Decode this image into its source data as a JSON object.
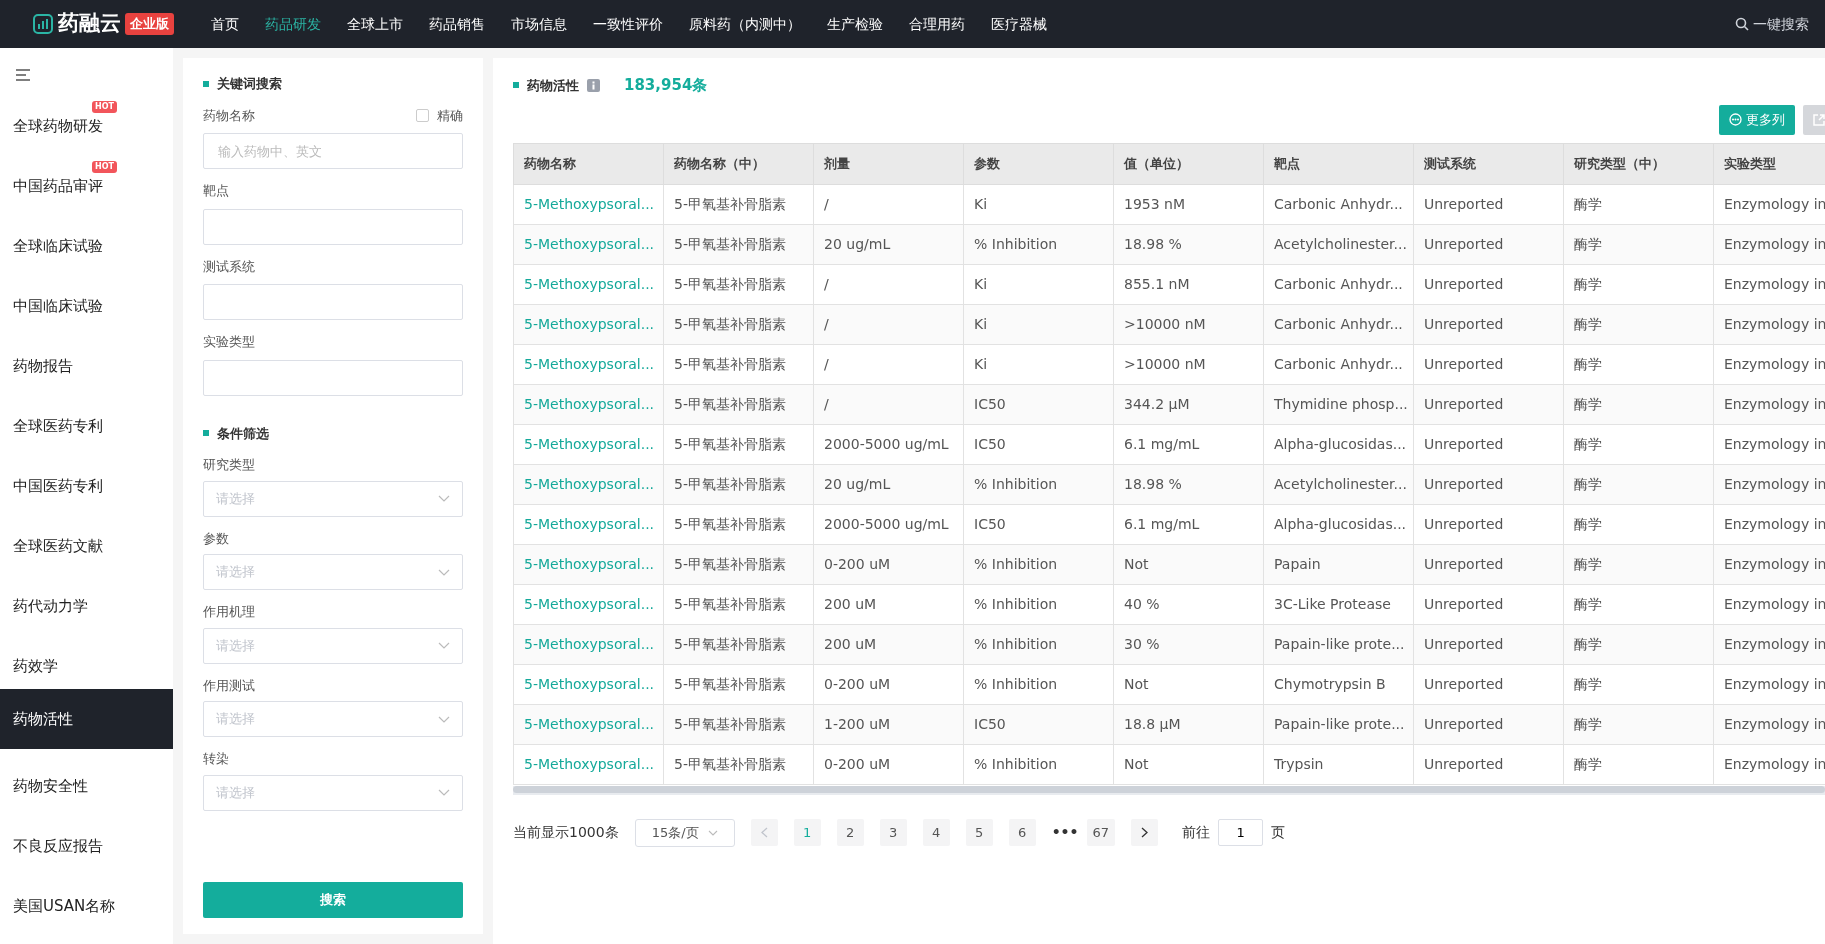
{
  "nav": {
    "logo_text": "药融云",
    "edition_badge": "企业版",
    "items": [
      {
        "label": "首页",
        "selected": false
      },
      {
        "label": "药品研发",
        "selected": true
      },
      {
        "label": "全球上市",
        "selected": false
      },
      {
        "label": "药品销售",
        "selected": false
      },
      {
        "label": "市场信息",
        "selected": false
      },
      {
        "label": "一致性评价",
        "selected": false
      },
      {
        "label": "原料药（内测中）",
        "selected": false
      },
      {
        "label": "生产检验",
        "selected": false
      },
      {
        "label": "合理用药",
        "selected": false
      },
      {
        "label": "医疗器械",
        "selected": false
      }
    ],
    "search_label": "一键搜索"
  },
  "sidebar": {
    "items": [
      {
        "label": "全球药物研发",
        "hot": "HOT",
        "selected": false
      },
      {
        "label": "中国药品审评",
        "hot": "HOT",
        "selected": false
      },
      {
        "label": "全球临床试验",
        "selected": false
      },
      {
        "label": "中国临床试验",
        "selected": false
      },
      {
        "label": "药物报告",
        "selected": false
      },
      {
        "label": "全球医药专利",
        "selected": false
      },
      {
        "label": "中国医药专利",
        "selected": false
      },
      {
        "label": "全球医药文献",
        "selected": false
      },
      {
        "label": "药代动力学",
        "selected": false
      },
      {
        "label": "药效学",
        "selected": false
      },
      {
        "label": "药物活性",
        "selected": true
      },
      {
        "label": "药物安全性",
        "selected": false
      },
      {
        "label": "不良反应报告",
        "selected": false
      },
      {
        "label": "美国USAN名称",
        "selected": false
      }
    ]
  },
  "filters": {
    "keyword_title": "关键词搜索",
    "exact": {
      "label": "精确",
      "checked": false
    },
    "fields": [
      {
        "label": "药物名称",
        "placeholder": "输入药物中、英文"
      },
      {
        "label": "靶点"
      },
      {
        "label": "测试系统"
      },
      {
        "label": "实验类型"
      }
    ],
    "condition_title": "条件筛选",
    "selects": [
      {
        "label": "研究类型",
        "placeholder": "请选择"
      },
      {
        "label": "参数",
        "placeholder": "请选择"
      },
      {
        "label": "作用机理",
        "placeholder": "请选择"
      },
      {
        "label": "作用测试",
        "placeholder": "请选择"
      },
      {
        "label": "转染",
        "placeholder": "请选择"
      }
    ],
    "search_button": "搜索"
  },
  "results": {
    "title": "药物活性",
    "count": "183,954条",
    "more_columns_button": "更多列"
  },
  "table": {
    "columns": [
      "药物名称",
      "药物名称（中）",
      "剂量",
      "参数",
      "值（单位）",
      "靶点",
      "测试系统",
      "研究类型（中）",
      "实验类型"
    ],
    "rows": [
      [
        "5-Methoxypsoral...",
        "5-甲氧基补骨脂素",
        "/",
        "Ki",
        "1953 nM",
        "Carbonic Anhydr...",
        "Unreported",
        "酶学",
        "Enzymology in"
      ],
      [
        "5-Methoxypsoral...",
        "5-甲氧基补骨脂素",
        "20 ug/mL",
        "% Inhibition",
        "18.98 %",
        "Acetylcholinester...",
        "Unreported",
        "酶学",
        "Enzymology in"
      ],
      [
        "5-Methoxypsoral...",
        "5-甲氧基补骨脂素",
        "/",
        "Ki",
        "855.1 nM",
        "Carbonic Anhydr...",
        "Unreported",
        "酶学",
        "Enzymology in"
      ],
      [
        "5-Methoxypsoral...",
        "5-甲氧基补骨脂素",
        "/",
        "Ki",
        ">10000 nM",
        "Carbonic Anhydr...",
        "Unreported",
        "酶学",
        "Enzymology in"
      ],
      [
        "5-Methoxypsoral...",
        "5-甲氧基补骨脂素",
        "/",
        "Ki",
        ">10000 nM",
        "Carbonic Anhydr...",
        "Unreported",
        "酶学",
        "Enzymology in"
      ],
      [
        "5-Methoxypsoral...",
        "5-甲氧基补骨脂素",
        "/",
        "IC50",
        "344.2 µM",
        "Thymidine phosp...",
        "Unreported",
        "酶学",
        "Enzymology in"
      ],
      [
        "5-Methoxypsoral...",
        "5-甲氧基补骨脂素",
        "2000-5000 ug/mL",
        "IC50",
        "6.1 mg/mL",
        "Alpha-glucosidas...",
        "Unreported",
        "酶学",
        "Enzymology in"
      ],
      [
        "5-Methoxypsoral...",
        "5-甲氧基补骨脂素",
        "20 ug/mL",
        "% Inhibition",
        "18.98 %",
        "Acetylcholinester...",
        "Unreported",
        "酶学",
        "Enzymology in"
      ],
      [
        "5-Methoxypsoral...",
        "5-甲氧基补骨脂素",
        "2000-5000 ug/mL",
        "IC50",
        "6.1 mg/mL",
        "Alpha-glucosidas...",
        "Unreported",
        "酶学",
        "Enzymology in"
      ],
      [
        "5-Methoxypsoral...",
        "5-甲氧基补骨脂素",
        "0-200 uM",
        "% Inhibition",
        "Not",
        "Papain",
        "Unreported",
        "酶学",
        "Enzymology in"
      ],
      [
        "5-Methoxypsoral...",
        "5-甲氧基补骨脂素",
        "200 uM",
        "% Inhibition",
        "40 %",
        "3C-Like Protease",
        "Unreported",
        "酶学",
        "Enzymology in"
      ],
      [
        "5-Methoxypsoral...",
        "5-甲氧基补骨脂素",
        "200 uM",
        "% Inhibition",
        "30 %",
        "Papain-like prote...",
        "Unreported",
        "酶学",
        "Enzymology in"
      ],
      [
        "5-Methoxypsoral...",
        "5-甲氧基补骨脂素",
        "0-200 uM",
        "% Inhibition",
        "Not",
        "Chymotrypsin B",
        "Unreported",
        "酶学",
        "Enzymology in"
      ],
      [
        "5-Methoxypsoral...",
        "5-甲氧基补骨脂素",
        "1-200 uM",
        "IC50",
        "18.8 µM",
        "Papain-like prote...",
        "Unreported",
        "酶学",
        "Enzymology in"
      ],
      [
        "5-Methoxypsoral...",
        "5-甲氧基补骨脂素",
        "0-200 uM",
        "% Inhibition",
        "Not",
        "Trypsin",
        "Unreported",
        "酶学",
        "Enzymology in"
      ]
    ]
  },
  "pagination": {
    "summary": "当前显示1000条",
    "page_size": "15条/页",
    "pages": [
      {
        "kind": "page",
        "label": "1",
        "selected": true
      },
      {
        "kind": "page",
        "label": "2",
        "selected": false
      },
      {
        "kind": "page",
        "label": "3",
        "selected": false
      },
      {
        "kind": "page",
        "label": "4",
        "selected": false
      },
      {
        "kind": "page",
        "label": "5",
        "selected": false
      },
      {
        "kind": "page",
        "label": "6",
        "selected": false
      },
      {
        "kind": "ellipsis",
        "label": "•••"
      },
      {
        "kind": "page",
        "label": "67",
        "selected": false
      }
    ],
    "goto_label": "前往",
    "goto_value": "1",
    "page_unit": "页"
  }
}
